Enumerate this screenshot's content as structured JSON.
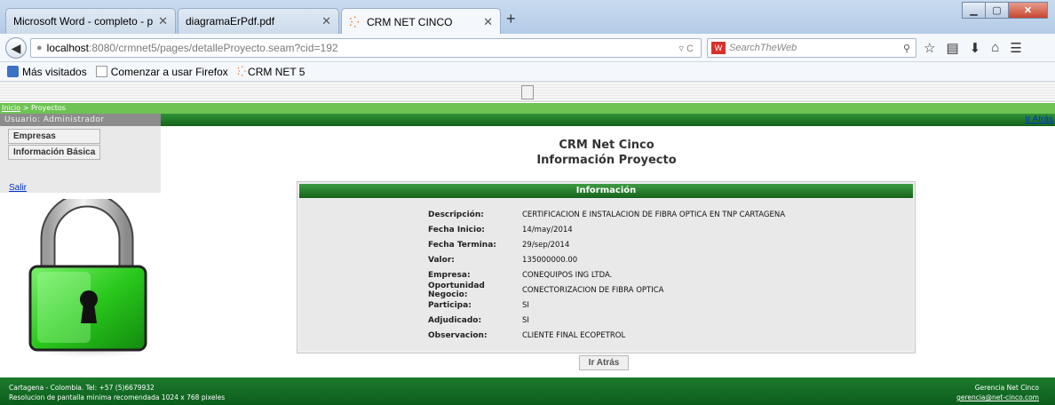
{
  "browser": {
    "tabs": [
      {
        "label": "Microsoft Word - completo - p..."
      },
      {
        "label": "diagramaErPdf.pdf"
      },
      {
        "label": "CRM NET CINCO"
      }
    ],
    "url_host": "localhost",
    "url_path": ":8080/crmnet5/pages/detalleProyecto.seam?cid=192",
    "search_placeholder": "SearchTheWeb",
    "bookmarks": [
      {
        "label": "Más visitados"
      },
      {
        "label": "Comenzar a usar Firefox"
      },
      {
        "label": "CRM NET 5"
      }
    ]
  },
  "page": {
    "breadcrumb": {
      "home": "Inicio",
      "separator": " > ",
      "current": "Proyectos"
    },
    "user_label": "Usuario: Administrador",
    "back_link": "Ir Atrás",
    "menu": [
      {
        "label": "Empresas"
      },
      {
        "label": "Información Básica"
      }
    ],
    "logout": "Salir",
    "title": "CRM Net Cinco",
    "subtitle": "Información Proyecto",
    "panel_title": "Información",
    "fields": [
      {
        "label": "Descripción:",
        "value": "CERTIFICACION E INSTALACION DE FIBRA OPTICA EN TNP CARTAGENA"
      },
      {
        "label": "Fecha Inicio:",
        "value": "14/may/2014"
      },
      {
        "label": "Fecha Termina:",
        "value": "29/sep/2014"
      },
      {
        "label": "Valor:",
        "value": "135000000.00"
      },
      {
        "label": "Empresa:",
        "value": "CONEQUIPOS ING LTDA."
      },
      {
        "label": "Oportunidad Negocio:",
        "value": "CONECTORIZACION DE FIBRA OPTICA"
      },
      {
        "label": "Participa:",
        "value": "SI"
      },
      {
        "label": "Adjudicado:",
        "value": "SI"
      },
      {
        "label": "Observacion:",
        "value": "CLIENTE FINAL ECOPETROL"
      }
    ],
    "back_button": "Ir Atrás"
  },
  "footer": {
    "line1": "Cartagena - Colombia. Tel: +57 (5)6679932",
    "line2": "Resolucion de pantalla minima recomendada 1024 x 768 pixeles",
    "company": "Gerencia Net Cinco",
    "email": "gerencia@net-cinco.com"
  },
  "colors": {
    "green_dark": "#16621c",
    "green_light": "#6ec353",
    "link_blue": "#0033cc"
  }
}
